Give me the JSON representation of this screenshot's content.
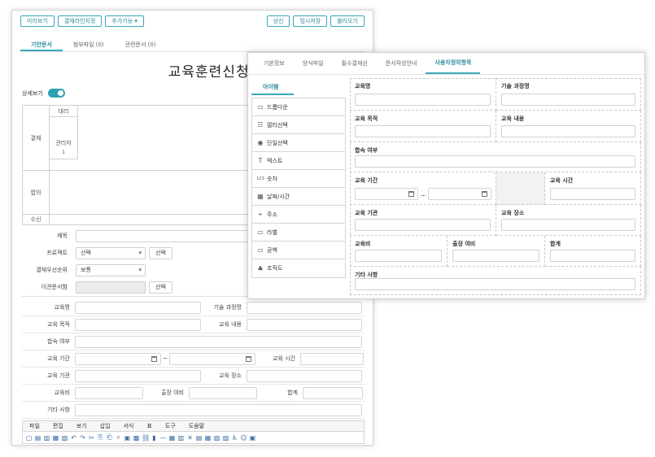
{
  "back": {
    "toolbar_left": [
      "미리보기",
      "결재라인지정",
      "추가기능 ▾"
    ],
    "toolbar_right": [
      "상신",
      "임시저장",
      "불러오기"
    ],
    "tabs": [
      "기안문서",
      "첨부파일 (0)",
      "관련문서 (0)"
    ],
    "title": "교육훈련신청서",
    "detail_label": "상세보기",
    "approval": {
      "row_labels": [
        "결재",
        "합의",
        "수신"
      ],
      "box": [
        "대리",
        "관리자",
        "1"
      ]
    },
    "fields": {
      "subject_label": "제목",
      "project_label": "프로젝트",
      "project_value": "선택",
      "project_btn": "선택",
      "priority_label": "결재우선순위",
      "priority_value": "보통",
      "transfer_label": "이관문서함",
      "transfer_btn": "선택"
    },
    "table": {
      "edu_name": "교육명",
      "tech": "기술 과정명",
      "edu_purpose": "교육 목적",
      "edu_content": "교육 내용",
      "lodging": "합숙 여부",
      "period": "교육 기간",
      "tilde": "~",
      "edu_time": "교육 시간",
      "institution": "교육 기관",
      "place": "교육 장소",
      "fee": "교육비",
      "travel": "출장 여비",
      "total": "합계",
      "etc": "기타 사항"
    },
    "editor_menu": [
      "파일",
      "편집",
      "보기",
      "삽입",
      "서식",
      "표",
      "도구",
      "도움말"
    ],
    "editor_tools": [
      "▢",
      "▤",
      "▥",
      "▦",
      "▧",
      "↶",
      "↷",
      "✂",
      "⎘",
      "⎗",
      "⌕",
      "▣",
      "▩",
      "⛓",
      "▮",
      "—",
      "▦",
      "▥",
      "✕",
      "▤",
      "▦",
      "▧",
      "▨",
      "♿",
      "☺",
      "▣"
    ]
  },
  "front": {
    "tabs": [
      "기본정보",
      "양식파일",
      "필수결재선",
      "문서작성안내",
      "사용자정의항목"
    ],
    "palette_title": "아이템",
    "palette_items": [
      {
        "icon": "▭",
        "label": "드롭다운"
      },
      {
        "icon": "☷",
        "label": "멀티선택"
      },
      {
        "icon": "◉",
        "label": "단일선택"
      },
      {
        "icon": "T",
        "label": "텍스트"
      },
      {
        "icon": "123",
        "label": "숫자"
      },
      {
        "icon": "▦",
        "label": "날짜/시간"
      },
      {
        "icon": "⌖",
        "label": "주소"
      },
      {
        "icon": "▭",
        "label": "라벨"
      },
      {
        "icon": "▭",
        "label": "공백"
      },
      {
        "icon": "♣",
        "label": "조직도"
      }
    ],
    "cells": {
      "edu_name": "교육명",
      "tech": "기술 과정명",
      "edu_purpose": "교육 목적",
      "edu_content": "교육 내용",
      "lodging": "합숙 여부",
      "period": "교육 기간",
      "tilde": "~",
      "edu_time": "교육 시간",
      "institution": "교육 기관",
      "place": "교육 장소",
      "fee": "교육비",
      "travel": "출장 여비",
      "total": "합계",
      "etc": "기타 사항"
    }
  }
}
